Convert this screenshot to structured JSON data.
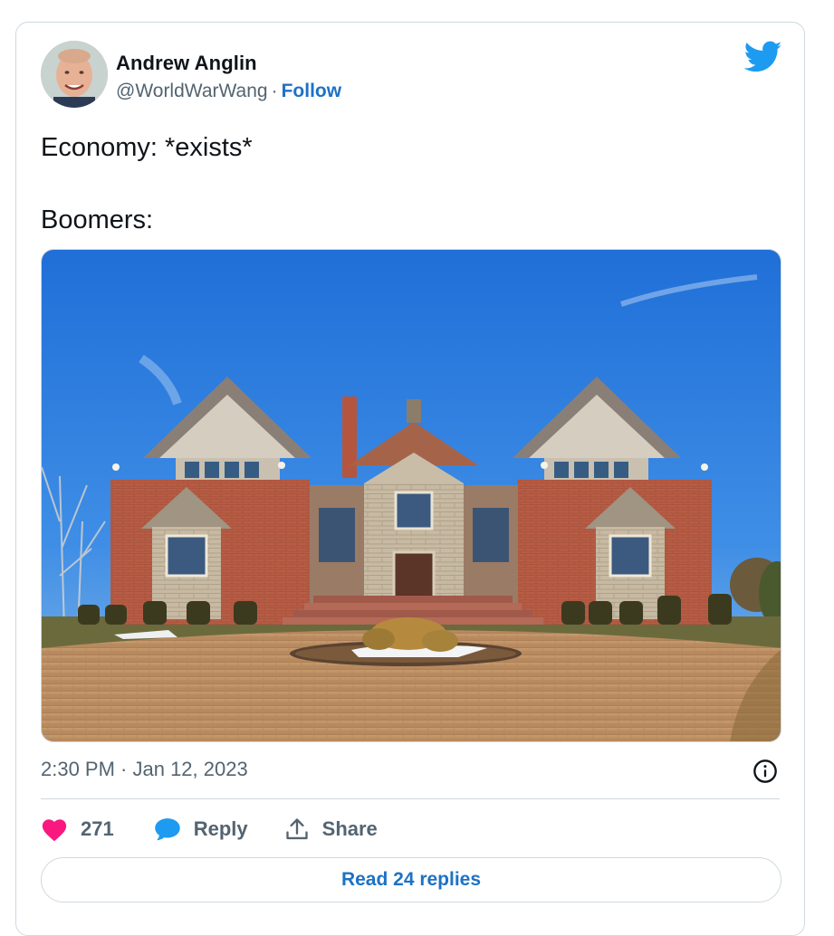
{
  "tweet": {
    "author": {
      "name": "Andrew Anglin",
      "handle": "@WorldWarWang",
      "separator": "·",
      "follow_label": "Follow"
    },
    "text": "Economy: *exists*\n\nBoomers:",
    "timestamp": "2:30 PM · Jan 12, 2023",
    "likes": "271",
    "reply_label": "Reply",
    "share_label": "Share",
    "read_replies_label": "Read 24 replies"
  },
  "icons": {
    "brand": "twitter-bird-icon",
    "info": "info-icon",
    "like": "heart-icon",
    "reply": "speech-bubble-icon",
    "share": "share-upload-icon"
  },
  "colors": {
    "brand_blue": "#1d9bf0",
    "link_blue": "#1d72c4",
    "like_pink": "#f91880",
    "muted_text": "#536471",
    "border": "#cfd9de"
  }
}
